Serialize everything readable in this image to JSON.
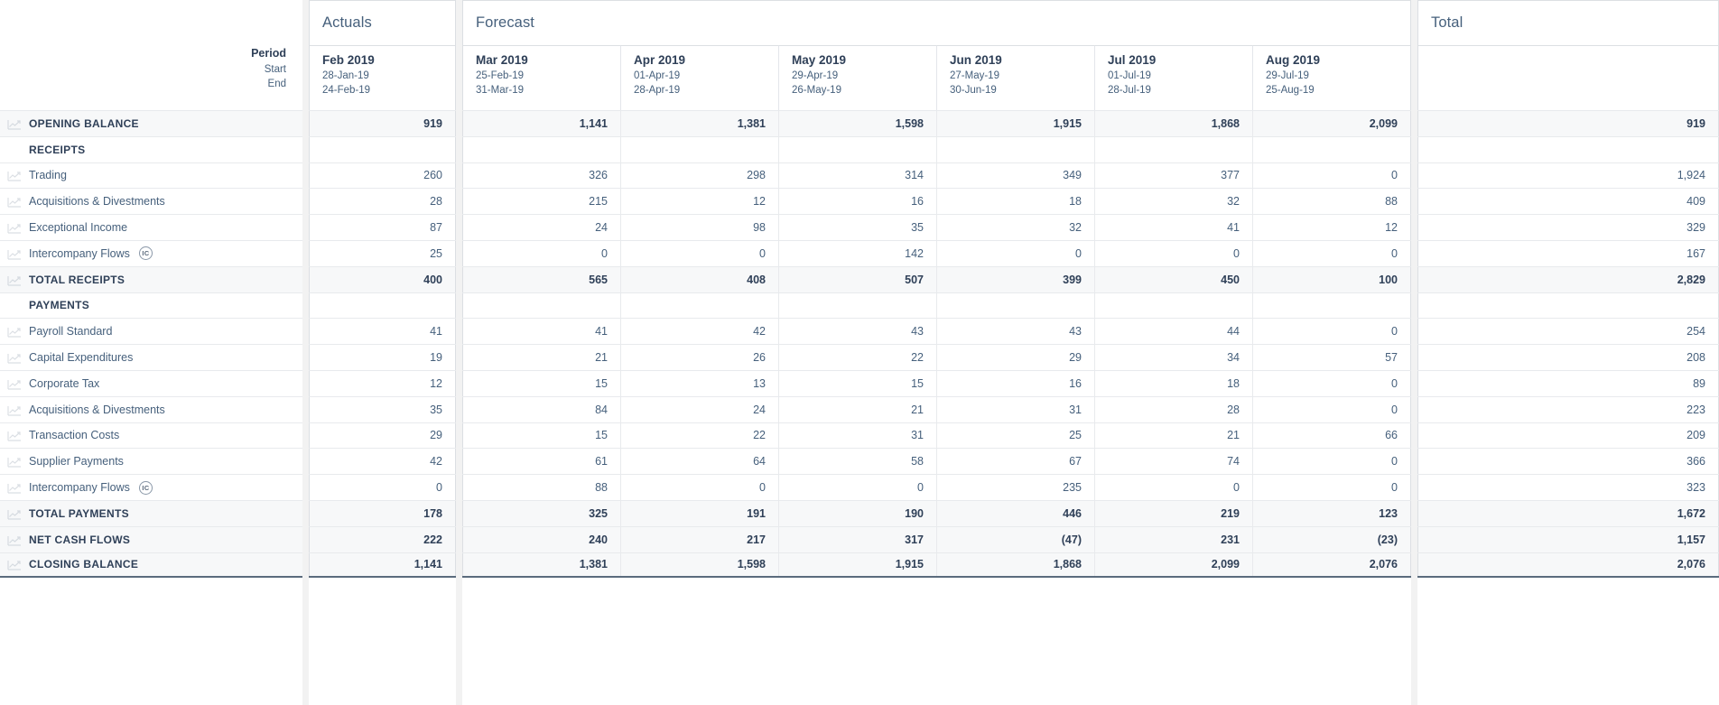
{
  "columns": {
    "label_header": {
      "period": "Period",
      "start": "Start",
      "end": "End"
    },
    "groups": [
      {
        "name": "actuals-group",
        "label": "Actuals"
      },
      {
        "name": "forecast-group",
        "label": "Forecast"
      },
      {
        "name": "total-group",
        "label": "Total"
      }
    ],
    "actuals": [
      {
        "month": "Feb 2019",
        "start": "28-Jan-19",
        "end": "24-Feb-19"
      }
    ],
    "forecast": [
      {
        "month": "Mar 2019",
        "start": "25-Feb-19",
        "end": "31-Mar-19"
      },
      {
        "month": "Apr 2019",
        "start": "01-Apr-19",
        "end": "28-Apr-19"
      },
      {
        "month": "May 2019",
        "start": "29-Apr-19",
        "end": "26-May-19"
      },
      {
        "month": "Jun 2019",
        "start": "27-May-19",
        "end": "30-Jun-19"
      },
      {
        "month": "Jul 2019",
        "start": "01-Jul-19",
        "end": "28-Jul-19"
      },
      {
        "month": "Aug 2019",
        "start": "29-Jul-19",
        "end": "25-Aug-19"
      }
    ],
    "total": [
      {
        "month": "",
        "start": "",
        "end": ""
      }
    ]
  },
  "rows": [
    {
      "label": "OPENING BALANCE",
      "bold": true,
      "shaded": true,
      "trend": true,
      "badge": "",
      "actuals": [
        "919"
      ],
      "forecast": [
        "1,141",
        "1,381",
        "1,598",
        "1,915",
        "1,868",
        "2,099"
      ],
      "total": [
        "919"
      ]
    },
    {
      "label": "RECEIPTS",
      "bold": true,
      "shaded": false,
      "trend": false,
      "badge": "",
      "actuals": [
        ""
      ],
      "forecast": [
        "",
        "",
        "",
        "",
        "",
        ""
      ],
      "total": [
        ""
      ]
    },
    {
      "label": "Trading",
      "bold": false,
      "shaded": false,
      "trend": true,
      "badge": "",
      "actuals": [
        "260"
      ],
      "forecast": [
        "326",
        "298",
        "314",
        "349",
        "377",
        "0"
      ],
      "total": [
        "1,924"
      ]
    },
    {
      "label": "Acquisitions & Divestments",
      "bold": false,
      "shaded": false,
      "trend": true,
      "badge": "",
      "actuals": [
        "28"
      ],
      "forecast": [
        "215",
        "12",
        "16",
        "18",
        "32",
        "88"
      ],
      "total": [
        "409"
      ]
    },
    {
      "label": "Exceptional Income",
      "bold": false,
      "shaded": false,
      "trend": true,
      "badge": "",
      "actuals": [
        "87"
      ],
      "forecast": [
        "24",
        "98",
        "35",
        "32",
        "41",
        "12"
      ],
      "total": [
        "329"
      ]
    },
    {
      "label": "Intercompany Flows",
      "bold": false,
      "shaded": false,
      "trend": true,
      "badge": "IC",
      "actuals": [
        "25"
      ],
      "forecast": [
        "0",
        "0",
        "142",
        "0",
        "0",
        "0"
      ],
      "total": [
        "167"
      ]
    },
    {
      "label": "TOTAL RECEIPTS",
      "bold": true,
      "shaded": true,
      "trend": true,
      "badge": "",
      "actuals": [
        "400"
      ],
      "forecast": [
        "565",
        "408",
        "507",
        "399",
        "450",
        "100"
      ],
      "total": [
        "2,829"
      ]
    },
    {
      "label": "PAYMENTS",
      "bold": true,
      "shaded": false,
      "trend": false,
      "badge": "",
      "actuals": [
        ""
      ],
      "forecast": [
        "",
        "",
        "",
        "",
        "",
        ""
      ],
      "total": [
        ""
      ]
    },
    {
      "label": "Payroll Standard",
      "bold": false,
      "shaded": false,
      "trend": true,
      "badge": "",
      "actuals": [
        "41"
      ],
      "forecast": [
        "41",
        "42",
        "43",
        "43",
        "44",
        "0"
      ],
      "total": [
        "254"
      ]
    },
    {
      "label": "Capital Expenditures",
      "bold": false,
      "shaded": false,
      "trend": true,
      "badge": "",
      "actuals": [
        "19"
      ],
      "forecast": [
        "21",
        "26",
        "22",
        "29",
        "34",
        "57"
      ],
      "total": [
        "208"
      ]
    },
    {
      "label": "Corporate Tax",
      "bold": false,
      "shaded": false,
      "trend": true,
      "badge": "",
      "actuals": [
        "12"
      ],
      "forecast": [
        "15",
        "13",
        "15",
        "16",
        "18",
        "0"
      ],
      "total": [
        "89"
      ]
    },
    {
      "label": "Acquisitions & Divestments",
      "bold": false,
      "shaded": false,
      "trend": true,
      "badge": "",
      "actuals": [
        "35"
      ],
      "forecast": [
        "84",
        "24",
        "21",
        "31",
        "28",
        "0"
      ],
      "total": [
        "223"
      ]
    },
    {
      "label": "Transaction Costs",
      "bold": false,
      "shaded": false,
      "trend": true,
      "badge": "",
      "actuals": [
        "29"
      ],
      "forecast": [
        "15",
        "22",
        "31",
        "25",
        "21",
        "66"
      ],
      "total": [
        "209"
      ]
    },
    {
      "label": "Supplier Payments",
      "bold": false,
      "shaded": false,
      "trend": true,
      "badge": "",
      "actuals": [
        "42"
      ],
      "forecast": [
        "61",
        "64",
        "58",
        "67",
        "74",
        "0"
      ],
      "total": [
        "366"
      ]
    },
    {
      "label": "Intercompany Flows",
      "bold": false,
      "shaded": false,
      "trend": true,
      "badge": "IC",
      "actuals": [
        "0"
      ],
      "forecast": [
        "88",
        "0",
        "0",
        "235",
        "0",
        "0"
      ],
      "total": [
        "323"
      ]
    },
    {
      "label": "TOTAL PAYMENTS",
      "bold": true,
      "shaded": true,
      "trend": true,
      "badge": "",
      "actuals": [
        "178"
      ],
      "forecast": [
        "325",
        "191",
        "190",
        "446",
        "219",
        "123"
      ],
      "total": [
        "1,672"
      ]
    },
    {
      "label": "NET CASH FLOWS",
      "bold": true,
      "shaded": true,
      "trend": true,
      "badge": "",
      "actuals": [
        "222"
      ],
      "forecast": [
        "240",
        "217",
        "317",
        "(47)",
        "231",
        "(23)"
      ],
      "total": [
        "1,157"
      ]
    },
    {
      "label": "CLOSING BALANCE",
      "bold": true,
      "shaded": true,
      "trend": true,
      "badge": "",
      "actuals": [
        "1,141"
      ],
      "forecast": [
        "1,381",
        "1,598",
        "1,915",
        "1,868",
        "2,099",
        "2,076"
      ],
      "total": [
        "2,076"
      ]
    }
  ],
  "icons": {
    "trend": "trend-line-icon",
    "intercompany_badge": "intercompany-badge-icon"
  },
  "colors": {
    "text_primary": "#2f4058",
    "text_secondary": "#46607c",
    "border": "#dcdfe3",
    "row_border": "#e8eaed",
    "shaded_row": "#f7f8f9",
    "gap": "#f2f2f2"
  }
}
